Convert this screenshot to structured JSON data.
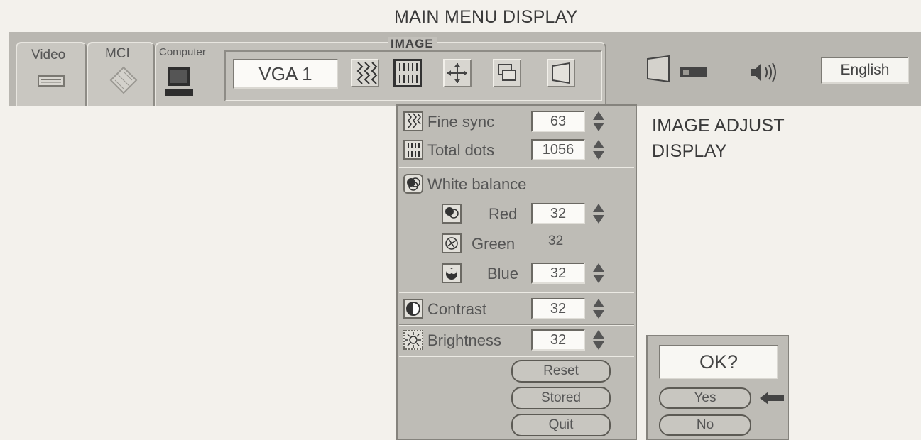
{
  "main_caption": "MAIN MENU DISPLAY",
  "image_caption_line1": "IMAGE ADJUST",
  "image_caption_line2": "DISPLAY",
  "menubar": {
    "tabs": [
      "Video",
      "MCI",
      "Computer"
    ],
    "section_label": "IMAGE",
    "source_value": "VGA 1",
    "language": "English"
  },
  "image_adjust": {
    "fine_sync": {
      "label": "Fine sync",
      "value": "63"
    },
    "total_dots": {
      "label": "Total dots",
      "value": "1056"
    },
    "white_balance": {
      "label": "White balance"
    },
    "red": {
      "label": "Red",
      "value": "32"
    },
    "green": {
      "label": "Green",
      "value": "32"
    },
    "blue": {
      "label": "Blue",
      "value": "32"
    },
    "contrast": {
      "label": "Contrast",
      "value": "32"
    },
    "brightness": {
      "label": "Brightness",
      "value": "32"
    },
    "buttons": {
      "reset": "Reset",
      "stored": "Stored",
      "quit": "Quit"
    }
  },
  "ok_dialog": {
    "prompt": "OK?",
    "yes": "Yes",
    "no": "No"
  },
  "colors": {
    "bar": "#b9b7b1",
    "panel": "#bebcb6",
    "box": "#fbfaf7"
  },
  "icons": [
    "video-port-icon",
    "mci-icon",
    "computer-icon",
    "fine-sync-icon",
    "total-dots-icon",
    "position-icon",
    "picture-icon",
    "keystone-icon",
    "screen-icon",
    "projector-icon",
    "speaker-icon",
    "white-balance-icon",
    "red-icon",
    "green-icon",
    "blue-icon",
    "contrast-icon",
    "brightness-icon",
    "arrow-left-icon"
  ]
}
